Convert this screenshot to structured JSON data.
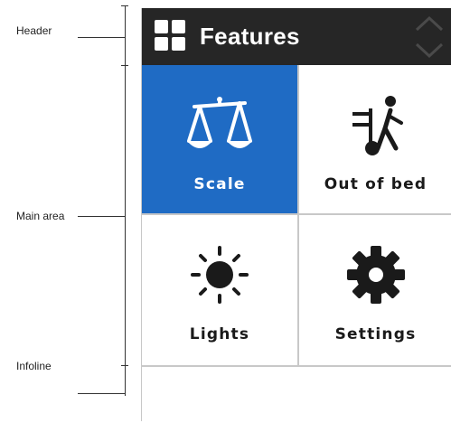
{
  "annotations": {
    "header": "Header",
    "main_area": "Main area",
    "infoline": "Infoline"
  },
  "header": {
    "title": "Features",
    "menu_icon": "grid-icon",
    "scroll_up_icon": "chevron-up-icon",
    "scroll_down_icon": "chevron-down-icon"
  },
  "tiles": [
    {
      "label": "Scale",
      "icon": "scale-icon",
      "active": true
    },
    {
      "label": "Out of bed",
      "icon": "out-of-bed-icon",
      "active": false
    },
    {
      "label": "Lights",
      "icon": "sun-icon",
      "active": false
    },
    {
      "label": "Settings",
      "icon": "gear-icon",
      "active": false
    }
  ],
  "infoline": {
    "text": ""
  },
  "colors": {
    "header_bg": "#262626",
    "accent": "#1f6bc4",
    "tile_bg": "#ffffff",
    "divider": "#c8c8c8"
  }
}
